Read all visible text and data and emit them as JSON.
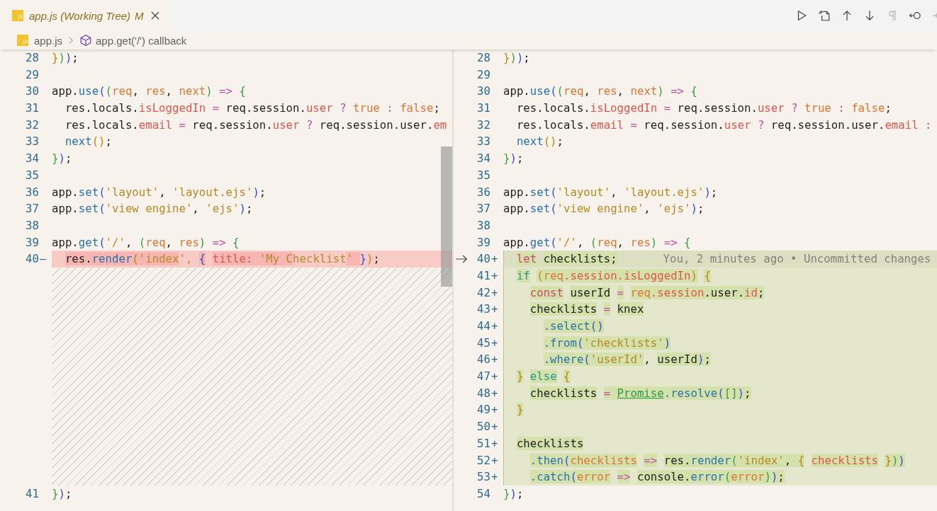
{
  "tab": {
    "icon_text": "JS",
    "title": "app.js (Working Tree)",
    "status": "M"
  },
  "breadcrumbs": [
    {
      "kind": "file",
      "icon_text": "JS",
      "label": "app.js"
    },
    {
      "kind": "symbol",
      "label": "app.get('/') callback"
    }
  ],
  "diff": {
    "left": [
      {
        "number": "28",
        "kind": "normal",
        "segments": [
          {
            "text": "}",
            "color": "#b8860b"
          },
          {
            "text": ")",
            "color": "#3a9a48"
          },
          {
            "text": ")",
            "color": "#2f52cf"
          },
          {
            "text": ";",
            "color": "#1f1f1f"
          }
        ]
      },
      {
        "number": "29",
        "kind": "normal"
      },
      {
        "number": "30",
        "kind": "normal",
        "segments": [
          {
            "text": "app.",
            "color": "#1f1f1f"
          },
          {
            "text": "use",
            "color": "#2a72ad"
          },
          {
            "text": "(",
            "color": "#2f52cf"
          },
          {
            "text": "(",
            "color": "#3a9a48"
          },
          {
            "text": "req",
            "color": "#dc7634"
          },
          {
            "text": ", ",
            "color": "#1f1f1f"
          },
          {
            "text": "res",
            "color": "#dc7634"
          },
          {
            "text": ", ",
            "color": "#1f1f1f"
          },
          {
            "text": "next",
            "color": "#dc7634"
          },
          {
            "text": ")",
            "color": "#3a9a48"
          },
          {
            "text": " =>",
            "color": "#c250a0"
          },
          {
            "text": " {",
            "color": "#3a9a48"
          }
        ]
      },
      {
        "number": "31",
        "kind": "normal",
        "segments": [
          {
            "text": "  res.locals.",
            "color": "#1f1f1f"
          },
          {
            "text": "isLoggedIn",
            "color": "#e0564c"
          },
          {
            "text": " =",
            "color": "#c250a0"
          },
          {
            "text": " req.session.",
            "color": "#1f1f1f"
          },
          {
            "text": "user",
            "color": "#e0564c"
          },
          {
            "text": " ?",
            "color": "#c250a0"
          },
          {
            "text": " true",
            "color": "#dc7634"
          },
          {
            "text": " :",
            "color": "#c250a0"
          },
          {
            "text": " false",
            "color": "#dc7634"
          },
          {
            "text": ";",
            "color": "#1f1f1f"
          }
        ]
      },
      {
        "number": "32",
        "kind": "normal",
        "segments": [
          {
            "text": "  res.locals.",
            "color": "#1f1f1f"
          },
          {
            "text": "email",
            "color": "#e0564c"
          },
          {
            "text": " =",
            "color": "#c250a0"
          },
          {
            "text": " req.session.",
            "color": "#1f1f1f"
          },
          {
            "text": "user",
            "color": "#e0564c"
          },
          {
            "text": " ?",
            "color": "#c250a0"
          },
          {
            "text": " req.session.user.",
            "color": "#1f1f1f"
          },
          {
            "text": "em",
            "color": "#e0564c"
          }
        ]
      },
      {
        "number": "33",
        "kind": "normal",
        "segments": [
          {
            "text": "  next",
            "color": "#2a72ad"
          },
          {
            "text": "()",
            "color": "#b8860b"
          },
          {
            "text": ";",
            "color": "#1f1f1f"
          }
        ]
      },
      {
        "number": "34",
        "kind": "normal",
        "segments": [
          {
            "text": "}",
            "color": "#3a9a48"
          },
          {
            "text": ")",
            "color": "#2f52cf"
          },
          {
            "text": ";",
            "color": "#1f1f1f"
          }
        ]
      },
      {
        "number": "35",
        "kind": "normal"
      },
      {
        "number": "36",
        "kind": "normal",
        "segments": [
          {
            "text": "app.",
            "color": "#1f1f1f"
          },
          {
            "text": "set",
            "color": "#2a72ad"
          },
          {
            "text": "(",
            "color": "#2f52cf"
          },
          {
            "text": "'layout'",
            "color": "#b58a24"
          },
          {
            "text": ", ",
            "color": "#1f1f1f"
          },
          {
            "text": "'layout.ejs'",
            "color": "#b58a24"
          },
          {
            "text": ")",
            "color": "#2f52cf"
          },
          {
            "text": ";",
            "color": "#1f1f1f"
          }
        ]
      },
      {
        "number": "37",
        "kind": "normal",
        "segments": [
          {
            "text": "app.",
            "color": "#1f1f1f"
          },
          {
            "text": "set",
            "color": "#2a72ad"
          },
          {
            "text": "(",
            "color": "#2f52cf"
          },
          {
            "text": "'view engine'",
            "color": "#b58a24"
          },
          {
            "text": ", ",
            "color": "#1f1f1f"
          },
          {
            "text": "'ejs'",
            "color": "#b58a24"
          },
          {
            "text": ")",
            "color": "#2f52cf"
          },
          {
            "text": ";",
            "color": "#1f1f1f"
          }
        ]
      },
      {
        "number": "38",
        "kind": "normal"
      },
      {
        "number": "39",
        "kind": "normal",
        "segments": [
          {
            "text": "app.",
            "color": "#1f1f1f"
          },
          {
            "text": "get",
            "color": "#2a72ad"
          },
          {
            "text": "(",
            "color": "#2f52cf"
          },
          {
            "text": "'/'",
            "color": "#b58a24"
          },
          {
            "text": ", ",
            "color": "#1f1f1f"
          },
          {
            "text": "(",
            "color": "#3a9a48"
          },
          {
            "text": "req",
            "color": "#dc7634"
          },
          {
            "text": ", ",
            "color": "#1f1f1f"
          },
          {
            "text": "res",
            "color": "#dc7634"
          },
          {
            "text": ")",
            "color": "#3a9a48"
          },
          {
            "text": " =>",
            "color": "#c250a0"
          },
          {
            "text": " {",
            "color": "#3a9a48"
          }
        ]
      },
      {
        "number": "40",
        "kind": "removed",
        "marker": "—",
        "segments": [
          {
            "text": "  res.",
            "color": "#1f1f1f",
            "changed": true
          },
          {
            "text": "render",
            "color": "#2a72ad",
            "changed": true
          },
          {
            "text": "(",
            "color": "#b8860b",
            "changed": true
          },
          {
            "text": "'index",
            "color": "#b58a24",
            "changed": true
          },
          {
            "text": "', ",
            "color": "#b58a24",
            "changed": false
          },
          {
            "text": "{",
            "color": "#2f52cf",
            "changed": true
          },
          {
            "text": " title",
            "color": "#e0564c",
            "changed": true
          },
          {
            "text": ": ",
            "color": "#e0564c",
            "changed": true
          },
          {
            "text": "'My C",
            "color": "#b58a24",
            "changed": true
          },
          {
            "text": "hecklist",
            "color": "#b58a24",
            "changed": false
          },
          {
            "text": "' ",
            "color": "#b58a24",
            "changed": true
          },
          {
            "text": "}",
            "color": "#2f52cf",
            "changed": false
          },
          {
            "text": ")",
            "color": "#b8860b",
            "changed": false
          },
          {
            "text": ";",
            "color": "#1f1f1f",
            "changed": false
          }
        ]
      },
      {
        "number": "41",
        "kind": "normal",
        "segments": [
          {
            "text": "}",
            "color": "#3a9a48"
          },
          {
            "text": ")",
            "color": "#2f52cf"
          },
          {
            "text": ";",
            "color": "#1f1f1f"
          }
        ]
      }
    ],
    "right": [
      {
        "number": "28",
        "kind": "normal",
        "segments": [
          {
            "text": "}",
            "color": "#b8860b"
          },
          {
            "text": ")",
            "color": "#3a9a48"
          },
          {
            "text": ")",
            "color": "#2f52cf"
          },
          {
            "text": ";",
            "color": "#1f1f1f"
          }
        ]
      },
      {
        "number": "29",
        "kind": "normal"
      },
      {
        "number": "30",
        "kind": "normal",
        "segments": [
          {
            "text": "app.",
            "color": "#1f1f1f"
          },
          {
            "text": "use",
            "color": "#2a72ad"
          },
          {
            "text": "(",
            "color": "#2f52cf"
          },
          {
            "text": "(",
            "color": "#3a9a48"
          },
          {
            "text": "req",
            "color": "#dc7634"
          },
          {
            "text": ", ",
            "color": "#1f1f1f"
          },
          {
            "text": "res",
            "color": "#dc7634"
          },
          {
            "text": ", ",
            "color": "#1f1f1f"
          },
          {
            "text": "next",
            "color": "#dc7634"
          },
          {
            "text": ")",
            "color": "#3a9a48"
          },
          {
            "text": " =>",
            "color": "#c250a0"
          },
          {
            "text": " {",
            "color": "#3a9a48"
          }
        ]
      },
      {
        "number": "31",
        "kind": "normal",
        "segments": [
          {
            "text": "  res.locals.",
            "color": "#1f1f1f"
          },
          {
            "text": "isLoggedIn",
            "color": "#e0564c"
          },
          {
            "text": " =",
            "color": "#c250a0"
          },
          {
            "text": " req.session.",
            "color": "#1f1f1f"
          },
          {
            "text": "user",
            "color": "#e0564c"
          },
          {
            "text": " ?",
            "color": "#c250a0"
          },
          {
            "text": " true",
            "color": "#dc7634"
          },
          {
            "text": " :",
            "color": "#c250a0"
          },
          {
            "text": " false",
            "color": "#dc7634"
          },
          {
            "text": ";",
            "color": "#1f1f1f"
          }
        ]
      },
      {
        "number": "32",
        "kind": "normal",
        "segments": [
          {
            "text": "  res.locals.",
            "color": "#1f1f1f"
          },
          {
            "text": "email",
            "color": "#e0564c"
          },
          {
            "text": " =",
            "color": "#c250a0"
          },
          {
            "text": " req.session.",
            "color": "#1f1f1f"
          },
          {
            "text": "user",
            "color": "#e0564c"
          },
          {
            "text": " ?",
            "color": "#c250a0"
          },
          {
            "text": " req.session.user.",
            "color": "#1f1f1f"
          },
          {
            "text": "email",
            "color": "#e0564c"
          },
          {
            "text": " :",
            "color": "#c250a0"
          }
        ]
      },
      {
        "number": "33",
        "kind": "normal",
        "segments": [
          {
            "text": "  next",
            "color": "#2a72ad"
          },
          {
            "text": "()",
            "color": "#b8860b"
          },
          {
            "text": ";",
            "color": "#1f1f1f"
          }
        ]
      },
      {
        "number": "34",
        "kind": "normal",
        "segments": [
          {
            "text": "}",
            "color": "#3a9a48"
          },
          {
            "text": ")",
            "color": "#2f52cf"
          },
          {
            "text": ";",
            "color": "#1f1f1f"
          }
        ]
      },
      {
        "number": "35",
        "kind": "normal"
      },
      {
        "number": "36",
        "kind": "normal",
        "segments": [
          {
            "text": "app.",
            "color": "#1f1f1f"
          },
          {
            "text": "set",
            "color": "#2a72ad"
          },
          {
            "text": "(",
            "color": "#2f52cf"
          },
          {
            "text": "'layout'",
            "color": "#b58a24"
          },
          {
            "text": ", ",
            "color": "#1f1f1f"
          },
          {
            "text": "'layout.ejs'",
            "color": "#b58a24"
          },
          {
            "text": ")",
            "color": "#2f52cf"
          },
          {
            "text": ";",
            "color": "#1f1f1f"
          }
        ]
      },
      {
        "number": "37",
        "kind": "normal",
        "segments": [
          {
            "text": "app.",
            "color": "#1f1f1f"
          },
          {
            "text": "set",
            "color": "#2a72ad"
          },
          {
            "text": "(",
            "color": "#2f52cf"
          },
          {
            "text": "'view engine'",
            "color": "#b58a24"
          },
          {
            "text": ", ",
            "color": "#1f1f1f"
          },
          {
            "text": "'ejs'",
            "color": "#b58a24"
          },
          {
            "text": ")",
            "color": "#2f52cf"
          },
          {
            "text": ";",
            "color": "#1f1f1f"
          }
        ]
      },
      {
        "number": "38",
        "kind": "normal"
      },
      {
        "number": "39",
        "kind": "normal",
        "segments": [
          {
            "text": "app.",
            "color": "#1f1f1f"
          },
          {
            "text": "get",
            "color": "#2a72ad"
          },
          {
            "text": "(",
            "color": "#2f52cf"
          },
          {
            "text": "'/'",
            "color": "#b58a24"
          },
          {
            "text": ", ",
            "color": "#1f1f1f"
          },
          {
            "text": "(",
            "color": "#3a9a48"
          },
          {
            "text": "req",
            "color": "#dc7634"
          },
          {
            "text": ", ",
            "color": "#1f1f1f"
          },
          {
            "text": "res",
            "color": "#dc7634"
          },
          {
            "text": ")",
            "color": "#3a9a48"
          },
          {
            "text": " =>",
            "color": "#c250a0"
          },
          {
            "text": " {",
            "color": "#3a9a48"
          }
        ]
      },
      {
        "number": "40",
        "kind": "added",
        "marker": "+",
        "blame": "You, 2 minutes ago • Uncommitted changes",
        "segments": [
          {
            "text": "  let",
            "color": "#c9486a",
            "changed": true
          },
          {
            "text": " checklists;",
            "color": "#1f1f1f",
            "changed": true
          }
        ]
      },
      {
        "number": "41",
        "kind": "added",
        "marker": "+",
        "segments": [
          {
            "text": "  if",
            "color": "#27978a",
            "changed": true
          },
          {
            "text": " (",
            "color": "#b8860b",
            "changed": true
          },
          {
            "text": "req",
            "color": "#dc7634",
            "changed": true
          },
          {
            "text": ".session.isLoggedIn",
            "color": "#e0564c",
            "changed": true
          },
          {
            "text": ")",
            "color": "#b8860b",
            "changed": true
          },
          {
            "text": " {",
            "color": "#b8860b",
            "changed": true
          }
        ]
      },
      {
        "number": "42",
        "kind": "added",
        "marker": "+",
        "segments": [
          {
            "text": "    const",
            "color": "#c9486a",
            "changed": true
          },
          {
            "text": " userId",
            "color": "#1f1f1f",
            "changed": true
          },
          {
            "text": " =",
            "color": "#c250a0",
            "changed": true
          },
          {
            "text": " req",
            "color": "#dc7634",
            "changed": true
          },
          {
            "text": ".session",
            "color": "#e0564c",
            "changed": true
          },
          {
            "text": ".user.",
            "color": "#1f1f1f",
            "changed": true
          },
          {
            "text": "id",
            "color": "#e0564c",
            "changed": true
          },
          {
            "text": ";",
            "color": "#1f1f1f",
            "changed": true
          }
        ]
      },
      {
        "number": "43",
        "kind": "added",
        "marker": "+",
        "segments": [
          {
            "text": "    checklists",
            "color": "#1f1f1f",
            "changed": true
          },
          {
            "text": " =",
            "color": "#c250a0",
            "changed": true
          },
          {
            "text": " knex",
            "color": "#1f1f1f",
            "changed": true
          }
        ]
      },
      {
        "number": "44",
        "kind": "added",
        "marker": "+",
        "segments": [
          {
            "text": "      .select",
            "color": "#2a72ad",
            "changed": true
          },
          {
            "text": "()",
            "color": "#2f52cf",
            "changed": true
          }
        ]
      },
      {
        "number": "45",
        "kind": "added",
        "marker": "+",
        "segments": [
          {
            "text": "      .from",
            "color": "#2a72ad",
            "changed": true
          },
          {
            "text": "(",
            "color": "#2f52cf",
            "changed": true
          },
          {
            "text": "'checklists'",
            "color": "#b58a24",
            "changed": true
          },
          {
            "text": ")",
            "color": "#2f52cf",
            "changed": true
          }
        ]
      },
      {
        "number": "46",
        "kind": "added",
        "marker": "+",
        "segments": [
          {
            "text": "      .where",
            "color": "#2a72ad",
            "changed": true
          },
          {
            "text": "(",
            "color": "#2f52cf",
            "changed": true
          },
          {
            "text": "'userId'",
            "color": "#b58a24",
            "changed": true
          },
          {
            "text": ", ",
            "color": "#1f1f1f",
            "changed": false
          },
          {
            "text": "userId",
            "color": "#1f1f1f",
            "changed": true
          },
          {
            "text": ")",
            "color": "#2f52cf",
            "changed": true
          },
          {
            "text": ";",
            "color": "#1f1f1f",
            "changed": true
          }
        ]
      },
      {
        "number": "47",
        "kind": "added",
        "marker": "+",
        "segments": [
          {
            "text": "  }",
            "color": "#b8860b",
            "changed": true
          },
          {
            "text": " else",
            "color": "#27978a",
            "changed": true
          },
          {
            "text": " {",
            "color": "#b8860b",
            "changed": true
          }
        ]
      },
      {
        "number": "48",
        "kind": "added",
        "marker": "+",
        "segments": [
          {
            "text": "    checklists",
            "color": "#1f1f1f",
            "changed": true
          },
          {
            "text": " = ",
            "color": "#c250a0",
            "changed": true
          },
          {
            "text": "Promise",
            "color": "#2f9a4e",
            "changed": true,
            "underlined": true
          },
          {
            "text": ".resolve",
            "color": "#2a72ad",
            "changed": true
          },
          {
            "text": "(",
            "color": "#2f52cf",
            "changed": true
          },
          {
            "text": "[]",
            "color": "#3a9a48",
            "changed": true
          },
          {
            "text": ")",
            "color": "#2f52cf",
            "changed": true
          },
          {
            "text": ";",
            "color": "#1f1f1f",
            "changed": true
          }
        ]
      },
      {
        "number": "49",
        "kind": "added",
        "marker": "+",
        "segments": [
          {
            "text": "  }",
            "color": "#b8860b",
            "changed": true
          }
        ]
      },
      {
        "number": "50",
        "kind": "added",
        "marker": "+"
      },
      {
        "number": "51",
        "kind": "added",
        "marker": "+",
        "segments": [
          {
            "text": "  checklists",
            "color": "#1f1f1f",
            "changed": true
          }
        ]
      },
      {
        "number": "52",
        "kind": "added",
        "marker": "+",
        "segments": [
          {
            "text": "    .then",
            "color": "#2a72ad",
            "changed": true
          },
          {
            "text": "(",
            "color": "#2f52cf",
            "changed": true
          },
          {
            "text": "checklists",
            "color": "#dc7634",
            "changed": true
          },
          {
            "text": " =>",
            "color": "#c250a0",
            "changed": true
          },
          {
            "text": " res.",
            "color": "#1f1f1f",
            "changed": true
          },
          {
            "text": "render",
            "color": "#2a72ad",
            "changed": true
          },
          {
            "text": "(",
            "color": "#3a9a48",
            "changed": true
          },
          {
            "text": "'index'",
            "color": "#b58a24",
            "changed": true
          },
          {
            "text": ", ",
            "color": "#1f1f1f",
            "changed": true
          },
          {
            "text": "{",
            "color": "#b8860b",
            "changed": true
          },
          {
            "text": " checklists",
            "color": "#e0564c",
            "changed": true
          },
          {
            "text": " }",
            "color": "#b8860b",
            "changed": true
          },
          {
            "text": ")",
            "color": "#3a9a48",
            "changed": true
          },
          {
            "text": ")",
            "color": "#2f52cf",
            "changed": true
          }
        ]
      },
      {
        "number": "53",
        "kind": "added",
        "marker": "+",
        "segments": [
          {
            "text": "    .catch",
            "color": "#2a72ad",
            "changed": true
          },
          {
            "text": "(",
            "color": "#2f52cf",
            "changed": true
          },
          {
            "text": "error",
            "color": "#dc7634",
            "changed": true
          },
          {
            "text": " =>",
            "color": "#c250a0",
            "changed": true
          },
          {
            "text": " console.",
            "color": "#1f1f1f",
            "changed": true
          },
          {
            "text": "error",
            "color": "#2a72ad",
            "changed": true
          },
          {
            "text": "(",
            "color": "#3a9a48",
            "changed": true
          },
          {
            "text": "error",
            "color": "#dc7634",
            "changed": true
          },
          {
            "text": ")",
            "color": "#3a9a48",
            "changed": true
          },
          {
            "text": ")",
            "color": "#2f52cf",
            "changed": true
          },
          {
            "text": ";",
            "color": "#1f1f1f",
            "changed": true
          }
        ]
      },
      {
        "number": "54",
        "kind": "normal",
        "segments": [
          {
            "text": "}",
            "color": "#3a9a48"
          },
          {
            "text": ")",
            "color": "#2f52cf"
          },
          {
            "text": ";",
            "color": "#1f1f1f"
          }
        ]
      }
    ]
  }
}
